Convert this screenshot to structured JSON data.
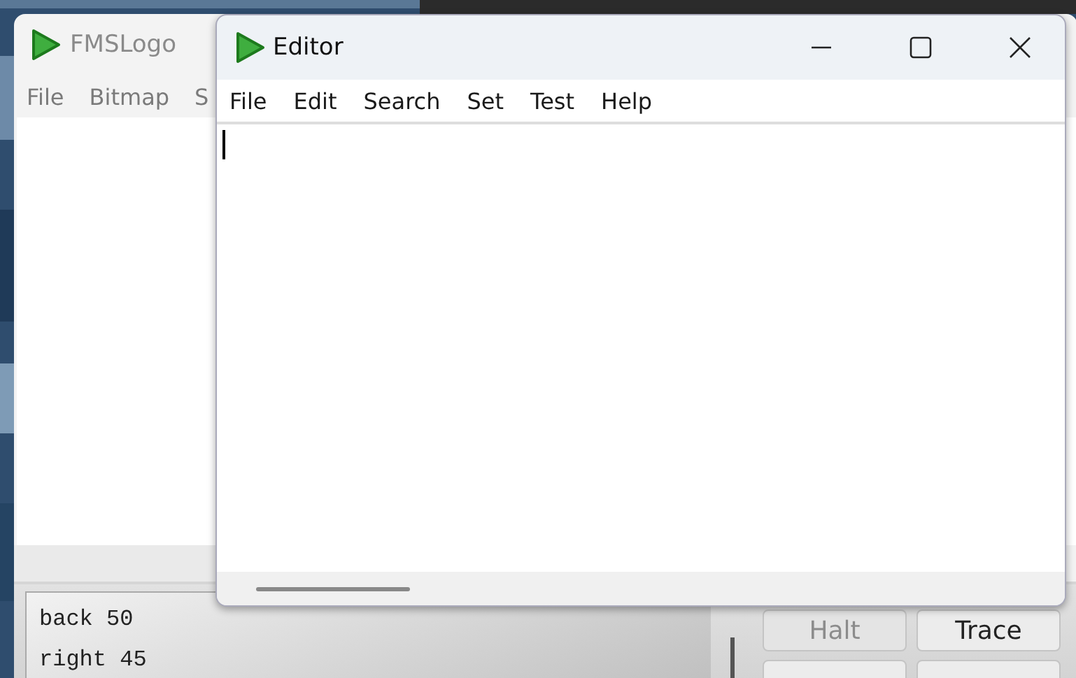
{
  "main_window": {
    "title": "FMSLogo",
    "menu": [
      "File",
      "Bitmap",
      "S"
    ],
    "history": [
      "back 50",
      "right 45"
    ],
    "buttons": [
      {
        "label": "Halt",
        "disabled": true
      },
      {
        "label": "Trace",
        "disabled": false
      }
    ]
  },
  "editor": {
    "title": "Editor",
    "menu": [
      "File",
      "Edit",
      "Search",
      "Set",
      "Test",
      "Help"
    ]
  }
}
